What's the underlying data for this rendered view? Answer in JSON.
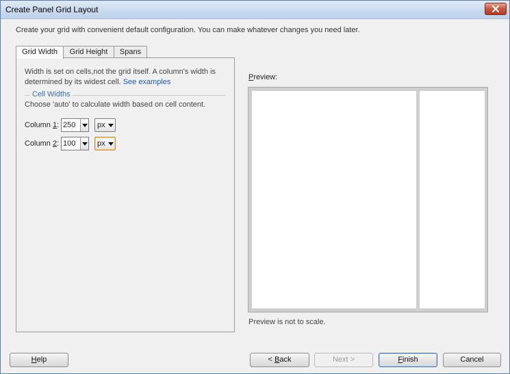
{
  "window": {
    "title": "Create Panel Grid Layout"
  },
  "intro": "Create your grid with convenient default configuration. You can make whatever changes you need later.",
  "tabs": [
    {
      "label": "Grid Width",
      "active": true
    },
    {
      "label": "Grid Height",
      "active": false
    },
    {
      "label": "Spans",
      "active": false
    }
  ],
  "grid_width": {
    "description": "Width is set on cells,not the grid itself. A column's width is determined by its widest cell.",
    "see_examples_link": "See examples",
    "section_title": "Cell Widths",
    "hint": "Choose 'auto' to calculate width based on cell content.",
    "columns": [
      {
        "label_prefix": "Column ",
        "label_mnemonic": "1",
        "label_suffix": ":",
        "value": "250",
        "unit": "px"
      },
      {
        "label_prefix": "Column ",
        "label_mnemonic": "2",
        "label_suffix": ":",
        "value": "100",
        "unit": "px"
      }
    ]
  },
  "preview": {
    "label_mnemonic": "P",
    "label_rest": "review:",
    "note": "Preview is not to scale."
  },
  "buttons": {
    "help_mnemonic": "H",
    "help_rest": "elp",
    "back_prefix": "< ",
    "back_mnemonic": "B",
    "back_rest": "ack",
    "next": "Next >",
    "finish_mnemonic": "F",
    "finish_rest": "inish",
    "cancel": "Cancel"
  },
  "colors": {
    "link": "#1f5aa8",
    "section_title": "#3a6ea5",
    "close_button": "#c7563f"
  }
}
